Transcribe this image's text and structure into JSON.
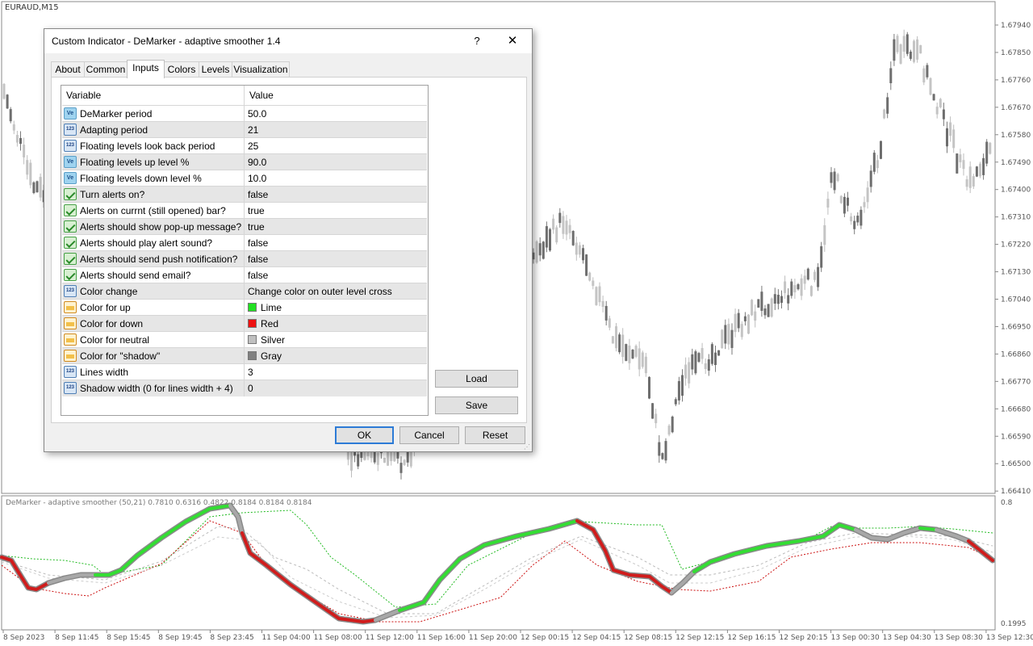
{
  "chart": {
    "symbol": "EURAUD,M15",
    "price_ticks": [
      "1.67940",
      "1.67850",
      "1.67760",
      "1.67670",
      "1.67580",
      "1.67490",
      "1.67400",
      "1.67310",
      "1.67220",
      "1.67130",
      "1.67040",
      "1.66950",
      "1.66860",
      "1.66770",
      "1.66680",
      "1.66590",
      "1.66500",
      "1.66410"
    ],
    "indicator_title": "DeMarker - adaptive smoother (50,21) 0.7810 0.6316 0.4822 0.8184 0.8184 0.8184",
    "indicator_ticks": [
      "0.8",
      "0.1995"
    ],
    "time_ticks": [
      "8 Sep 2023",
      "8 Sep 11:45",
      "8 Sep 15:45",
      "8 Sep 19:45",
      "8 Sep 23:45",
      "11 Sep 04:00",
      "11 Sep 08:00",
      "11 Sep 12:00",
      "11 Sep 16:00",
      "11 Sep 20:00",
      "12 Sep 00:15",
      "12 Sep 04:15",
      "12 Sep 08:15",
      "12 Sep 12:15",
      "12 Sep 16:15",
      "12 Sep 20:15",
      "13 Sep 00:30",
      "13 Sep 04:30",
      "13 Sep 08:30",
      "13 Sep 12:30"
    ],
    "colors": {
      "up": "#33dd33",
      "down": "#d01c1c",
      "neutral": "#a8a8a8",
      "candle": "#888888"
    }
  },
  "dialog": {
    "title": "Custom Indicator - DeMarker - adaptive smoother 1.4",
    "help": "?",
    "close": "✕",
    "tabs": [
      "About",
      "Common",
      "Inputs",
      "Colors",
      "Levels",
      "Visualization"
    ],
    "active_tab": "Inputs",
    "columns": {
      "variable": "Variable",
      "value": "Value"
    },
    "rows": [
      {
        "icon": "ve",
        "name": "DeMarker period",
        "value": "50.0"
      },
      {
        "icon": "123",
        "name": "Adapting period",
        "value": "21"
      },
      {
        "icon": "123",
        "name": "Floating levels look back period",
        "value": "25"
      },
      {
        "icon": "ve",
        "name": "Floating levels up level %",
        "value": "90.0"
      },
      {
        "icon": "ve",
        "name": "Floating levels down level %",
        "value": "10.0"
      },
      {
        "icon": "bool",
        "name": "Turn alerts on?",
        "value": "false"
      },
      {
        "icon": "bool",
        "name": "Alerts on currnt (still opened) bar?",
        "value": "true"
      },
      {
        "icon": "bool",
        "name": "Alerts should show pop-up message?",
        "value": "true"
      },
      {
        "icon": "bool",
        "name": "Alerts should play alert sound?",
        "value": "false"
      },
      {
        "icon": "bool",
        "name": "Alerts should send push notification?",
        "value": "false"
      },
      {
        "icon": "bool",
        "name": "Alerts should send email?",
        "value": "false"
      },
      {
        "icon": "123",
        "name": "Color change",
        "value": "Change color on outer level cross"
      },
      {
        "icon": "color",
        "name": "Color for up",
        "value": "Lime",
        "swatch": "#22e022"
      },
      {
        "icon": "color",
        "name": "Color for down",
        "value": "Red",
        "swatch": "#ee1111"
      },
      {
        "icon": "color",
        "name": "Color for neutral",
        "value": "Silver",
        "swatch": "#c0c0c0"
      },
      {
        "icon": "color",
        "name": "Color for \"shadow\"",
        "value": "Gray",
        "swatch": "#808080"
      },
      {
        "icon": "123",
        "name": "Lines width",
        "value": "3"
      },
      {
        "icon": "123",
        "name": "Shadow width (0 for lines width + 4)",
        "value": "0"
      }
    ],
    "buttons": {
      "load": "Load",
      "save": "Save",
      "ok": "OK",
      "cancel": "Cancel",
      "reset": "Reset"
    }
  }
}
